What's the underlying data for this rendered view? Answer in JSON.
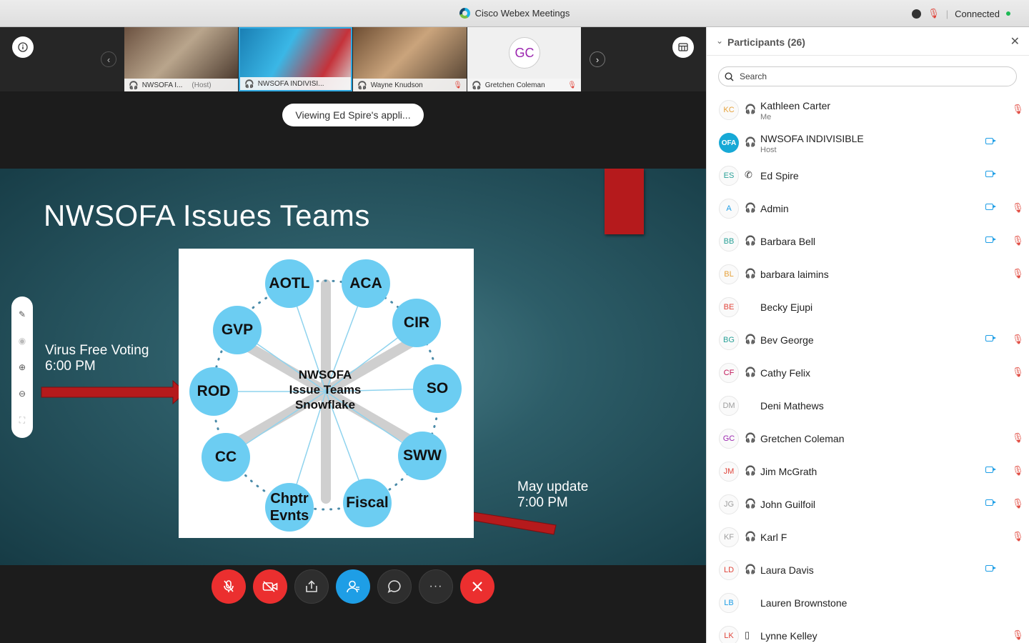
{
  "window": {
    "title": "Cisco Webex Meetings",
    "status": "Connected"
  },
  "thumbnails": [
    {
      "name": "NWSOFA I...",
      "role": "(Host)",
      "muted": false
    },
    {
      "name": "NWSOFA INDIVISI...",
      "role": "",
      "muted": false,
      "active": true
    },
    {
      "name": "Wayne Knudson",
      "role": "",
      "muted": true
    },
    {
      "name": "Gretchen Coleman",
      "role": "",
      "muted": true,
      "initials": "GC"
    }
  ],
  "viewing_banner": "Viewing Ed Spire's appli...",
  "slide": {
    "title": "NWSOFA Issues Teams",
    "note_left": [
      "Virus Free Voting",
      "6:00 PM"
    ],
    "note_right": [
      "May update",
      "7:00 PM"
    ],
    "diagram_center": [
      "NWSOFA",
      "Issue Teams",
      "Snowflake"
    ],
    "nodes": [
      "AOTL",
      "ACA",
      "CIR",
      "SO",
      "SWW",
      "Fiscal",
      "Chptr Evnts",
      "CC",
      "ROD",
      "GVP"
    ]
  },
  "controls": [
    "mute-button",
    "stop-video-button",
    "share-button",
    "participants-button",
    "chat-button",
    "more-button",
    "leave-button"
  ],
  "participants_panel": {
    "title": "Participants (26)",
    "search_placeholder": "Search",
    "participants": [
      {
        "initials": "KC",
        "name": "Kathleen Carter",
        "sub": "Me",
        "color": "#e6a23c",
        "audio": "headset",
        "video": false,
        "muted": true
      },
      {
        "initials": "OFA",
        "name": "NWSOFA INDIVISIBLE",
        "sub": "Host",
        "color": "#17a9d6",
        "audio": "headset",
        "video": true,
        "muted": false
      },
      {
        "initials": "ES",
        "name": "Ed Spire",
        "sub": "",
        "color": "#2aa198",
        "audio": "phone",
        "video": true,
        "muted": false
      },
      {
        "initials": "A",
        "name": "Admin",
        "sub": "",
        "color": "#1e9ee6",
        "audio": "headset",
        "video": true,
        "muted": true
      },
      {
        "initials": "BB",
        "name": "Barbara Bell",
        "sub": "",
        "color": "#2aa198",
        "audio": "headset",
        "video": true,
        "muted": true
      },
      {
        "initials": "BL",
        "name": "barbara laimins",
        "sub": "",
        "color": "#e6a23c",
        "audio": "headset",
        "video": false,
        "muted": true
      },
      {
        "initials": "BE",
        "name": "Becky Ejupi",
        "sub": "",
        "color": "#e0453b",
        "audio": "none",
        "video": false,
        "muted": false
      },
      {
        "initials": "BG",
        "name": "Bev George",
        "sub": "",
        "color": "#2aa198",
        "audio": "headset",
        "video": true,
        "muted": true
      },
      {
        "initials": "CF",
        "name": "Cathy Felix",
        "sub": "",
        "color": "#c2185b",
        "audio": "headset",
        "video": false,
        "muted": true
      },
      {
        "initials": "DM",
        "name": "Deni Mathews",
        "sub": "",
        "color": "#9e9e9e",
        "audio": "none",
        "video": false,
        "muted": false
      },
      {
        "initials": "GC",
        "name": "Gretchen Coleman",
        "sub": "",
        "color": "#9c27b0",
        "audio": "headset",
        "video": false,
        "muted": true
      },
      {
        "initials": "JM",
        "name": "Jim McGrath",
        "sub": "",
        "color": "#e0453b",
        "audio": "headset",
        "video": true,
        "muted": true
      },
      {
        "initials": "JG",
        "name": "John Guilfoil",
        "sub": "",
        "color": "#9e9e9e",
        "audio": "headset",
        "video": true,
        "muted": true
      },
      {
        "initials": "KF",
        "name": "Karl F",
        "sub": "",
        "color": "#9e9e9e",
        "audio": "headset",
        "video": false,
        "muted": true
      },
      {
        "initials": "LD",
        "name": "Laura Davis",
        "sub": "",
        "color": "#e0453b",
        "audio": "headset",
        "video": true,
        "muted": false
      },
      {
        "initials": "LB",
        "name": "Lauren Brownstone",
        "sub": "",
        "color": "#1e9ee6",
        "audio": "none",
        "video": false,
        "muted": false
      },
      {
        "initials": "LK",
        "name": "Lynne Kelley",
        "sub": "",
        "color": "#e0453b",
        "audio": "mobile",
        "video": false,
        "muted": true
      }
    ]
  }
}
